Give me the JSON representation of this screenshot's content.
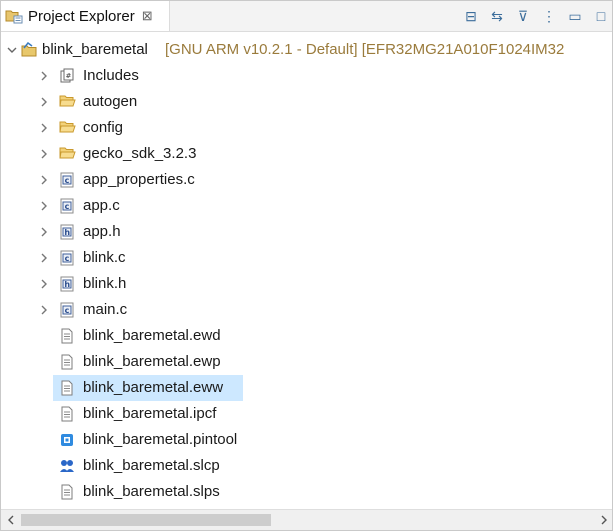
{
  "tab": {
    "title": "Project Explorer",
    "close_glyph": "⊠"
  },
  "toolbar": {
    "buttons": [
      {
        "name": "collapse-all-icon",
        "glyph": "⊟"
      },
      {
        "name": "link-with-editor-icon",
        "glyph": "⇆"
      },
      {
        "name": "filter-icon",
        "glyph": "⊽"
      },
      {
        "name": "view-menu-icon",
        "glyph": "⋮"
      },
      {
        "name": "minimize-icon",
        "glyph": "▭"
      },
      {
        "name": "maximize-icon",
        "glyph": "□"
      }
    ]
  },
  "tree": {
    "project": {
      "name": "blink_baremetal",
      "decoration": "[GNU ARM v10.2.1 - Default] [EFR32MG21A010F1024IM32"
    },
    "items": [
      {
        "label": "Includes",
        "icon": "includes-icon",
        "expandable": true
      },
      {
        "label": "autogen",
        "icon": "folder-icon",
        "expandable": true
      },
      {
        "label": "config",
        "icon": "folder-icon",
        "expandable": true
      },
      {
        "label": "gecko_sdk_3.2.3",
        "icon": "folder-icon",
        "expandable": true
      },
      {
        "label": "app_properties.c",
        "icon": "c-file-icon",
        "expandable": true
      },
      {
        "label": "app.c",
        "icon": "c-file-icon",
        "expandable": true
      },
      {
        "label": "app.h",
        "icon": "h-file-icon",
        "expandable": true
      },
      {
        "label": "blink.c",
        "icon": "c-file-icon",
        "expandable": true
      },
      {
        "label": "blink.h",
        "icon": "h-file-icon",
        "expandable": true
      },
      {
        "label": "main.c",
        "icon": "c-file-icon",
        "expandable": true
      },
      {
        "label": "blink_baremetal.ewd",
        "icon": "text-file-icon",
        "expandable": false
      },
      {
        "label": "blink_baremetal.ewp",
        "icon": "text-file-icon",
        "expandable": false
      },
      {
        "label": "blink_baremetal.eww",
        "icon": "text-file-icon",
        "expandable": false,
        "selected": true
      },
      {
        "label": "blink_baremetal.ipcf",
        "icon": "text-file-icon",
        "expandable": false
      },
      {
        "label": "blink_baremetal.pintool",
        "icon": "pintool-file-icon",
        "expandable": false
      },
      {
        "label": "blink_baremetal.slcp",
        "icon": "slcp-file-icon",
        "expandable": false
      },
      {
        "label": "blink_baremetal.slps",
        "icon": "text-file-icon",
        "expandable": false
      }
    ]
  },
  "colors": {
    "selection": "#cde8ff",
    "decoration": "#9a7b3c",
    "folder": "#d9a93b"
  }
}
